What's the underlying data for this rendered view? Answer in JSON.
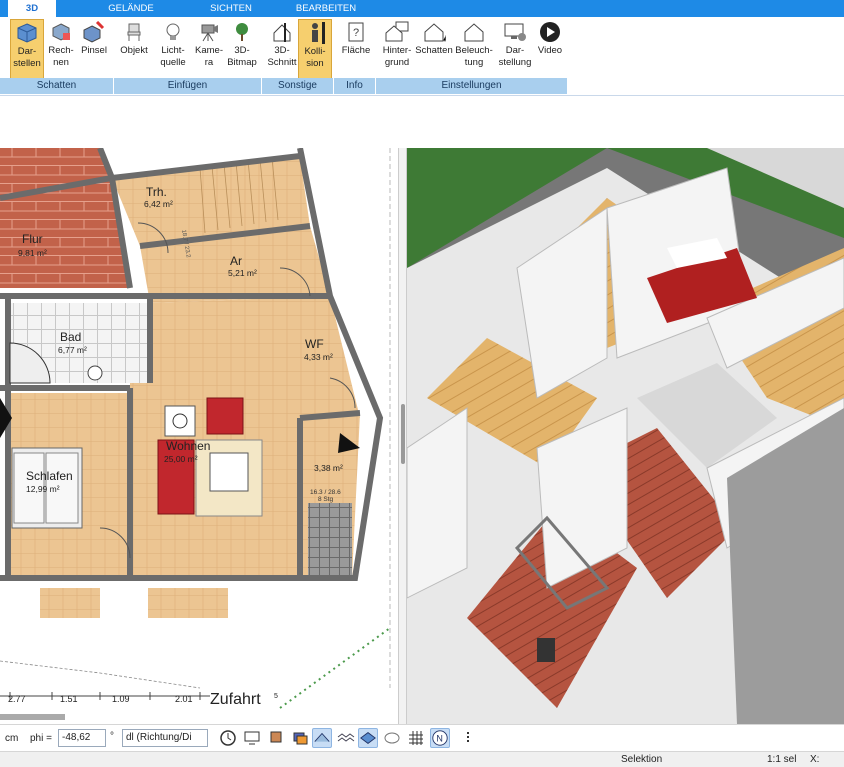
{
  "tabs": [
    {
      "label": "3D",
      "active": true
    },
    {
      "label": "GELÄNDE",
      "active": false
    },
    {
      "label": "SICHTEN",
      "active": false
    },
    {
      "label": "BEARBEITEN",
      "active": false
    }
  ],
  "ribbon": {
    "buttons": [
      {
        "label": "Dar-\nstellen",
        "icon": "cube-icon",
        "active": true
      },
      {
        "label": "Rech-\nnen",
        "icon": "cube-calc-icon",
        "active": false
      },
      {
        "label": "Pinsel",
        "icon": "paint-cube-icon",
        "active": false
      },
      {
        "label": "Objekt",
        "icon": "chair-icon",
        "active": false
      },
      {
        "label": "Licht-\nquelle",
        "icon": "lightbulb-icon",
        "active": false
      },
      {
        "label": "Kame-\nra",
        "icon": "camera-icon",
        "active": false
      },
      {
        "label": "3D-\nBitmap",
        "icon": "tree-icon",
        "active": false
      },
      {
        "label": "3D-\nSchnitt",
        "icon": "section-icon",
        "active": false
      },
      {
        "label": "Kolli-\nsion",
        "icon": "person-icon",
        "active": true
      },
      {
        "label": "Fläche",
        "icon": "area-info-icon",
        "active": false
      },
      {
        "label": "Hinter-\ngrund",
        "icon": "house-bg-icon",
        "active": false
      },
      {
        "label": "Schatten",
        "icon": "house-shadow-icon",
        "active": false
      },
      {
        "label": "Beleuch-\ntung",
        "icon": "house-light-icon",
        "active": false
      },
      {
        "label": "Dar-\nstellung",
        "icon": "monitor-gear-icon",
        "active": false
      },
      {
        "label": "Video",
        "icon": "play-icon",
        "active": false
      }
    ],
    "groups": [
      "Schatten",
      "Einfügen",
      "Sonstige",
      "Info",
      "Einstellungen"
    ]
  },
  "plan": {
    "rooms": [
      {
        "name": "Flur",
        "area": "9,81 m²"
      },
      {
        "name": "Trh.",
        "area": "6,42 m²"
      },
      {
        "name": "Ar",
        "area": "5,21 m²"
      },
      {
        "name": "Bad",
        "area": "6,77 m²"
      },
      {
        "name": "WF",
        "area": "4,33 m²"
      },
      {
        "name": "Wohnen",
        "area": "25,00 m²"
      },
      {
        "name": "Schlafen",
        "area": "12,99 m²"
      },
      {
        "name": "",
        "area": "3,38 m²"
      }
    ],
    "stair_note_1": "18.7 / 23.2",
    "stair_note_2": "16.3 / 28.6",
    "stair_note_3": "8 Stg",
    "dimensions": [
      "2.77",
      "1.51",
      "1.09",
      "2.01",
      "5"
    ],
    "street_label": "Zufahrt"
  },
  "toolbar": {
    "unit": "cm",
    "phi_label": "phi =",
    "phi_value": "-48,62",
    "phi_unit": "°",
    "dl_value": "dl (Richtung/Di",
    "icons": [
      "clock-icon",
      "monitor-icon",
      "stamp-icon",
      "layers-icon",
      "roof-icon",
      "wave-icon",
      "plane-icon",
      "hatch-icon",
      "grid-icon",
      "north-icon",
      "dots-icon"
    ]
  },
  "status": {
    "mode": "Selektion",
    "selection": "1:1 sel",
    "coord_label": "X:"
  },
  "colors": {
    "accent": "#1e8ae6",
    "active_button": "#f6cf6e",
    "group_bar": "#a9cfee",
    "wood_floor": "#e9c088",
    "tile_floor": "#b85b45"
  }
}
